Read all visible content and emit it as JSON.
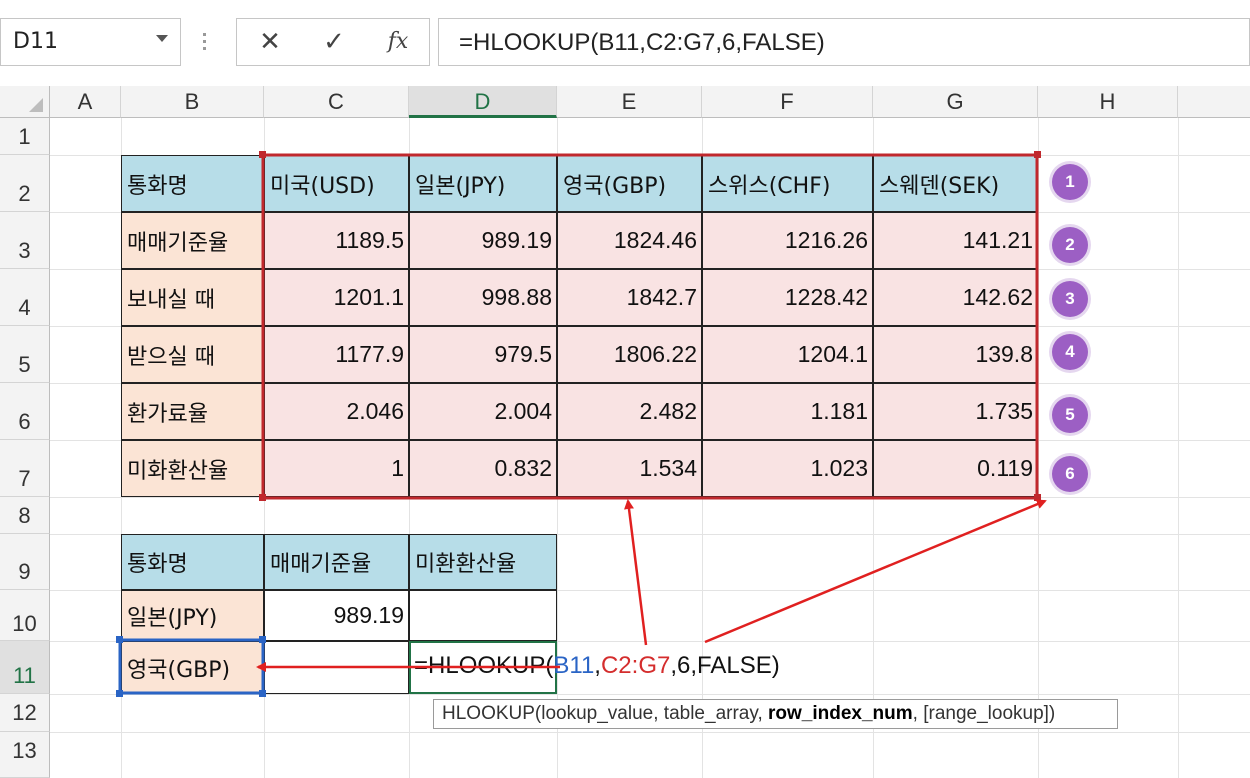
{
  "formula_bar": {
    "name_box": "D11",
    "cancel_icon": "cancel-icon",
    "enter_icon": "enter-icon",
    "fx_label": "fx",
    "formula": "=HLOOKUP(B11,C2:G7,6,FALSE)"
  },
  "columns": [
    "A",
    "B",
    "C",
    "D",
    "E",
    "F",
    "G",
    "H"
  ],
  "rows": [
    "1",
    "2",
    "3",
    "4",
    "5",
    "6",
    "7",
    "8",
    "9",
    "10",
    "11",
    "12",
    "13"
  ],
  "table": {
    "corner_label": "통화명",
    "headers": [
      "미국(USD)",
      "일본(JPY)",
      "영국(GBP)",
      "스위스(CHF)",
      "스웨덴(SEK)"
    ],
    "rows": [
      {
        "label": "매매기준율",
        "values": [
          "1189.5",
          "989.19",
          "1824.46",
          "1216.26",
          "141.21"
        ]
      },
      {
        "label": "보내실 때",
        "values": [
          "1201.1",
          "998.88",
          "1842.7",
          "1228.42",
          "142.62"
        ]
      },
      {
        "label": "받으실 때",
        "values": [
          "1177.9",
          "979.5",
          "1806.22",
          "1204.1",
          "139.8"
        ]
      },
      {
        "label": "환가료율",
        "values": [
          "2.046",
          "2.004",
          "2.482",
          "1.181",
          "1.735"
        ]
      },
      {
        "label": "미화환산율",
        "values": [
          "1",
          "0.832",
          "1.534",
          "1.023",
          "0.119"
        ]
      }
    ]
  },
  "badges": [
    "1",
    "2",
    "3",
    "4",
    "5",
    "6"
  ],
  "lookup_table": {
    "headers": [
      "통화명",
      "매매기준율",
      "미환환산율"
    ],
    "row10": {
      "name": "일본(JPY)",
      "rate": "989.19",
      "converted": ""
    },
    "row11": {
      "name": "영국(GBP)"
    }
  },
  "editing_formula": {
    "prefix": "=HLOOKUP(",
    "ref1": "B11",
    "sep1": ",",
    "ref2": "C2:G7",
    "rest": ",6,FALSE)"
  },
  "tooltip": {
    "fn": "HLOOKUP(",
    "arg1": "lookup_value, ",
    "arg2": "table_array, ",
    "arg3": "row_index_num",
    "arg4": ", [range_lookup])"
  },
  "colors": {
    "header_fill": "#b7dde8",
    "row_label_fill": "#fbe4d5",
    "data_fill": "#f9e3e3",
    "selection_red": "#c0282d",
    "badge_purple": "#9c5fc4",
    "active_green": "#217346"
  }
}
